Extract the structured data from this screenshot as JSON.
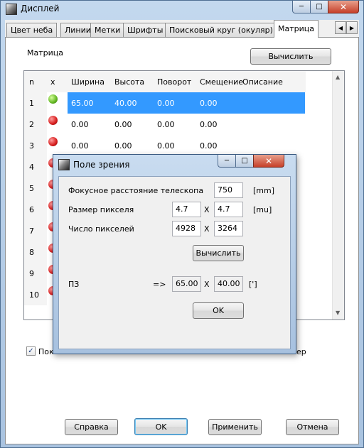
{
  "window": {
    "title": "Дисплей"
  },
  "tabs": [
    "Цвет неба",
    "Линии",
    "Метки",
    "Шрифты",
    "Поисковый круг (окуляр)",
    "Матрица"
  ],
  "panel": {
    "label": "Матрица",
    "compute_button": "Вычислить"
  },
  "grid": {
    "columns": [
      "n",
      "x",
      "Ширина",
      "Высота",
      "Поворот",
      "Смещение",
      "Описание"
    ],
    "rows": [
      {
        "n": "1",
        "status": "green",
        "width": "65.00",
        "height": "40.00",
        "rotation": "0.00",
        "offset": "0.00"
      },
      {
        "n": "2",
        "status": "red",
        "width": "0.00",
        "height": "0.00",
        "rotation": "0.00",
        "offset": "0.00"
      },
      {
        "n": "3",
        "status": "red",
        "width": "0.00",
        "height": "0.00",
        "rotation": "0.00",
        "offset": "0.00"
      },
      {
        "n": "4",
        "status": "red"
      },
      {
        "n": "5",
        "status": "red"
      },
      {
        "n": "6",
        "status": "red"
      },
      {
        "n": "7",
        "status": "red"
      },
      {
        "n": "8",
        "status": "red"
      },
      {
        "n": "9",
        "status": "red"
      },
      {
        "n": "10",
        "status": "red"
      }
    ]
  },
  "checkboxes": {
    "left_label": "Пок",
    "right_label": "ер"
  },
  "bottom_buttons": {
    "help": "Справка",
    "ok": "OK",
    "apply": "Применить",
    "cancel": "Отмена"
  },
  "dialog": {
    "title": "Поле зрения",
    "focal_label": "Фокусное расстояние телескопа",
    "focal_value": "750",
    "focal_unit": "[mm]",
    "pixel_size_label": "Размер пикселя",
    "pixel_w": "4.7",
    "pixel_h": "4.7",
    "pixel_unit": "[mu]",
    "x1": "X",
    "pixel_count_label": "Число пикселей",
    "count_w": "4928",
    "count_h": "3264",
    "x2": "X",
    "compute_button": "Вычислить",
    "fov_label": "ПЗ",
    "arrow": "=>",
    "fov_w": "65.00",
    "x3": "X",
    "fov_h": "40.00",
    "fov_unit": "[']",
    "ok_button": "OK"
  },
  "colors": {
    "selection": "#3399ff",
    "title_bg": "#b9d1ea",
    "close_button": "#c6402a"
  }
}
